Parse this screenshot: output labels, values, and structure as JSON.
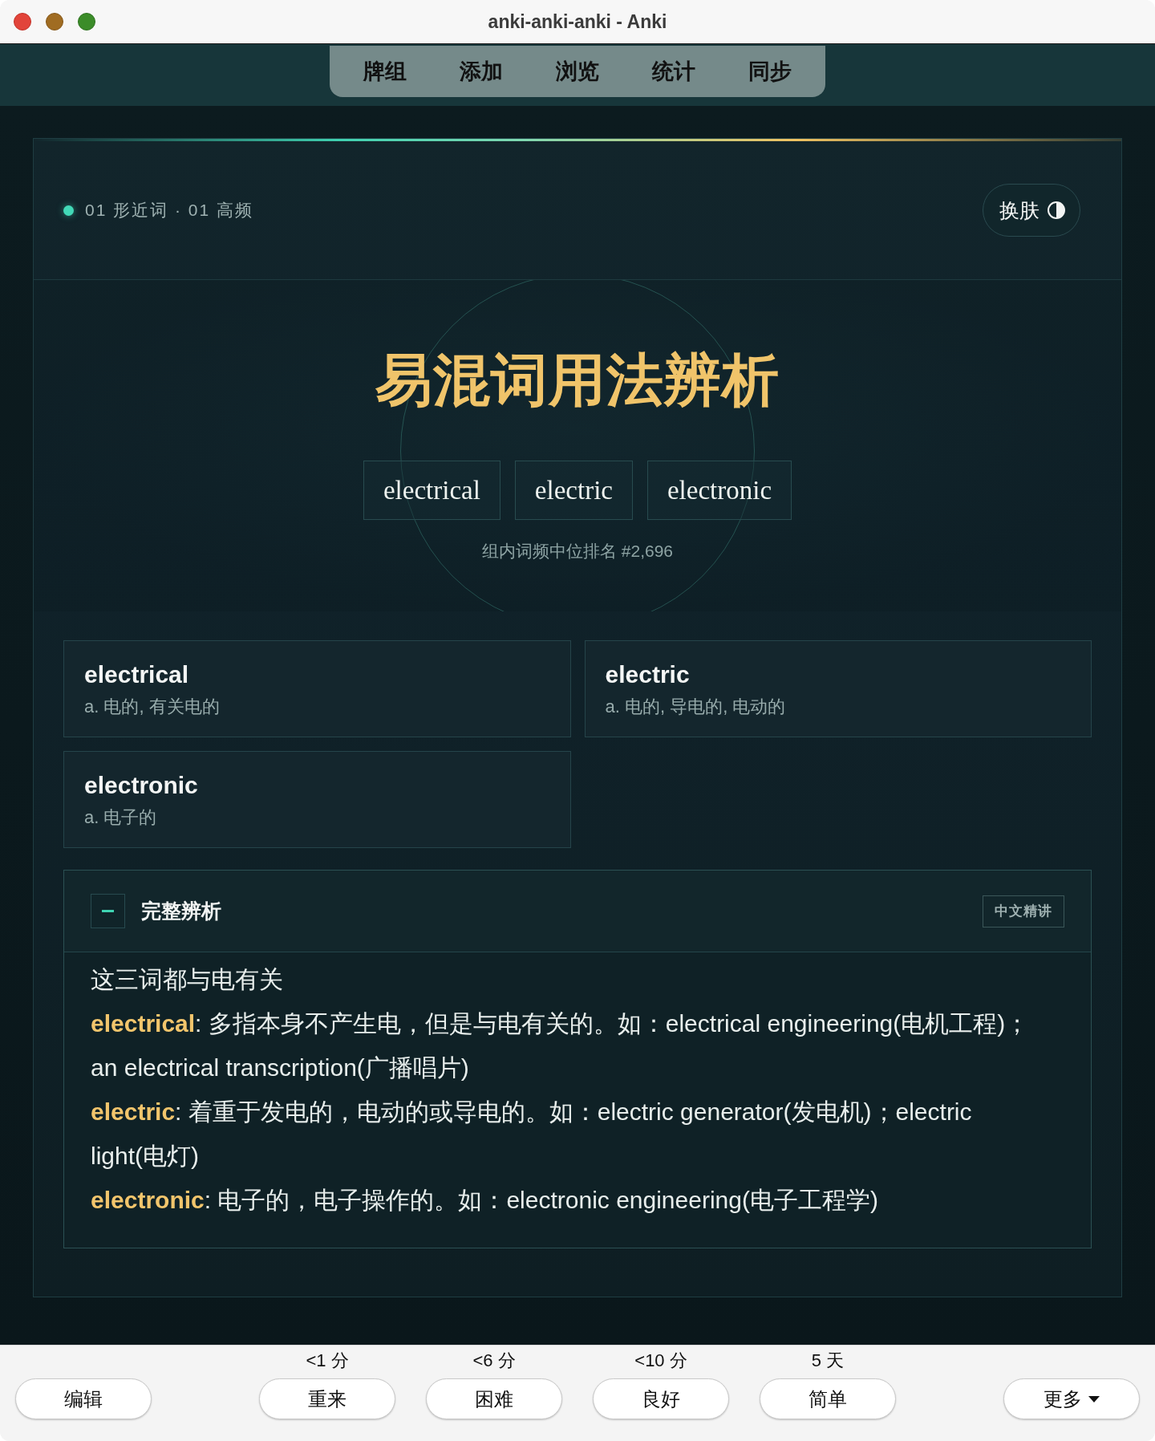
{
  "window": {
    "title": "anki-anki-anki - Anki"
  },
  "toolbar": {
    "tabs": [
      {
        "label": "牌组",
        "selected": false
      },
      {
        "label": "添加",
        "selected": false
      },
      {
        "label": "浏览",
        "selected": false
      },
      {
        "label": "统计",
        "selected": false
      },
      {
        "label": "同步",
        "selected": false
      }
    ]
  },
  "card": {
    "breadcrumb": "01 形近词 · 01 高频",
    "theme_button": "换肤",
    "title": "易混词用法辨析",
    "words": [
      "electrical",
      "electric",
      "electronic"
    ],
    "rank": "组内词频中位排名 #2,696",
    "definitions": [
      {
        "word": "electrical",
        "meaning": "a. 电的, 有关电的"
      },
      {
        "word": "electric",
        "meaning": "a. 电的, 导电的, 电动的"
      },
      {
        "word": "electronic",
        "meaning": "a. 电子的"
      }
    ],
    "analysis": {
      "title": "完整辨析",
      "expanded": true,
      "badge": "中文精讲",
      "intro": "这三词都与电有关",
      "paragraphs": [
        "**electrical**: 多指本身不产生电，但是与电有关的。如：electrical engineering(电机工程)；an electrical transcription(广播唱片)",
        "**electric**: 着重于发电的，电动的或导电的。如：electric generator(发电机)；electric light(电灯)",
        "**electronic**: 电子的，电子操作的。如：electronic engineering(电子工程学)"
      ]
    }
  },
  "answer_bar": {
    "edit_button": "编辑",
    "answers": [
      {
        "interval": "<1 分",
        "label": "重来"
      },
      {
        "interval": "<6 分",
        "label": "困难"
      },
      {
        "interval": "<10 分",
        "label": "良好"
      },
      {
        "interval": "5 天",
        "label": "简单"
      }
    ],
    "more_button": "更多"
  }
}
